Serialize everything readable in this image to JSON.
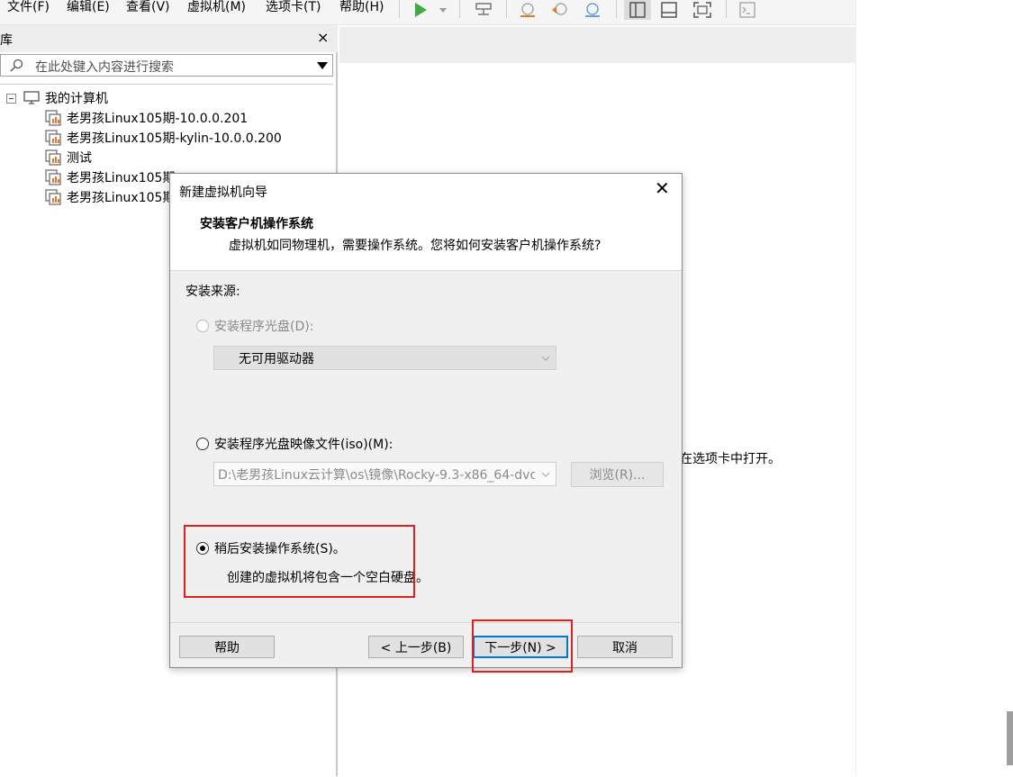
{
  "menubar": {
    "items": [
      "文件(F)",
      "编辑(E)",
      "查看(V)",
      "虚拟机(M)",
      "选项卡(T)",
      "帮助(H)"
    ]
  },
  "toolbar": {
    "icons": [
      "play-icon",
      "dropdown-arrow-icon",
      "network-icon",
      "snapshot-icon",
      "revert-snapshot-icon",
      "snapshot-manager-icon",
      "library-view-icon",
      "single-view-icon",
      "fullscreen-icon",
      "console-icon"
    ]
  },
  "library": {
    "title": "库",
    "close": "×",
    "search_placeholder": "在此处键入内容进行搜索",
    "root": "我的计算机",
    "items": [
      "老男孩Linux105期-10.0.0.201",
      "老男孩Linux105期-kylin-10.0.0.200",
      "测试",
      "老男孩Linux105期",
      "老男孩Linux105期"
    ]
  },
  "content": {
    "note": "在选项卡中打开。"
  },
  "dialog": {
    "title": "新建虚拟机向导",
    "close": "✕",
    "heading": "安装客户机操作系统",
    "description": "虚拟机如同物理机，需要操作系统。您将如何安装客户机操作系统?",
    "source_label": "安装来源:",
    "option_disc": {
      "label": "安装程序光盘(D):",
      "selected": false,
      "enabled": false,
      "combo_value": "无可用驱动器"
    },
    "option_iso": {
      "label": "安装程序光盘映像文件(iso)(M):",
      "selected": false,
      "enabled": true,
      "path_value": "D:\\老男孩Linux云计算\\os\\镜像\\Rocky-9.3-x86_64-dvc",
      "browse_label": "浏览(R)..."
    },
    "option_later": {
      "label": "稍后安装操作系统(S)。",
      "selected": true,
      "description": "创建的虚拟机将包含一个空白硬盘。"
    },
    "buttons": {
      "help": "帮助",
      "back": "< 上一步(B)",
      "next": "下一步(N) >",
      "cancel": "取消"
    }
  },
  "colors": {
    "annotation": "#e0201e",
    "default_button_border": "#0078d7",
    "play_green": "#3dab3d"
  }
}
